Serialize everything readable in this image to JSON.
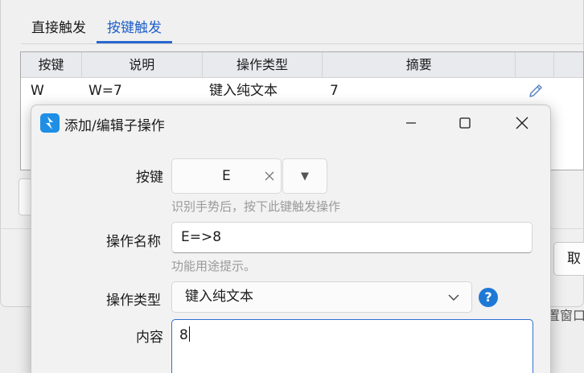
{
  "background_window": {
    "tabs": [
      {
        "label": "直接触发",
        "active": false
      },
      {
        "label": "按键触发",
        "active": true
      }
    ],
    "table": {
      "columns": [
        "按键",
        "说明",
        "操作类型",
        "摘要"
      ],
      "rows": [
        {
          "key": "W",
          "desc": "W=7",
          "type": "键入纯文本",
          "summary": "7",
          "action_icon": "pencil-icon"
        }
      ]
    },
    "cancel_partial": "取消",
    "reset_partial": "置窗口"
  },
  "dialog": {
    "title": "添加/编辑子操作",
    "app_icon": "shortcut-app-icon",
    "fields": {
      "key": {
        "label": "按键",
        "value": "E",
        "hint": "识别手势后，按下此键触发操作"
      },
      "name": {
        "label": "操作名称",
        "value": "E=>8",
        "hint": "功能用途提示。"
      },
      "type": {
        "label": "操作类型",
        "selected": "键入纯文本"
      },
      "content": {
        "label": "内容",
        "value": "8"
      }
    }
  },
  "colors": {
    "accent": "#1e5fc9",
    "help_icon": "#1e78d6",
    "app_icon": "#1f8fe6",
    "focus_border": "#2f6fd0"
  }
}
